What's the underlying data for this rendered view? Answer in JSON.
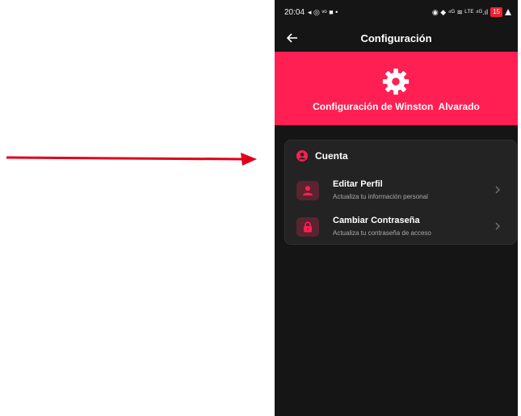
{
  "status_bar": {
    "time": "20:04",
    "left_glyphs": "◂ ◎ ᵛᵒ ■ •",
    "right_glyphs": "◉ ◆ ⁴ᴳ ≋ ᴸᵀᴱ ⁴ᴳ.ıl",
    "battery": "15"
  },
  "app_bar": {
    "title": "Configuración"
  },
  "hero": {
    "title": "Configuración de Winston  Alvarado"
  },
  "account": {
    "header": "Cuenta",
    "options": [
      {
        "title": "Editar Perfil",
        "subtitle": "Actualiza tu información personal",
        "icon": "person-icon"
      },
      {
        "title": "Cambiar Contraseña",
        "subtitle": "Actualiza tu contraseña de acceso",
        "icon": "lock-icon"
      }
    ]
  },
  "colors": {
    "accent": "#ff1f52",
    "background": "#151515",
    "card": "#232323",
    "annotation_arrow": "#e0001a"
  }
}
